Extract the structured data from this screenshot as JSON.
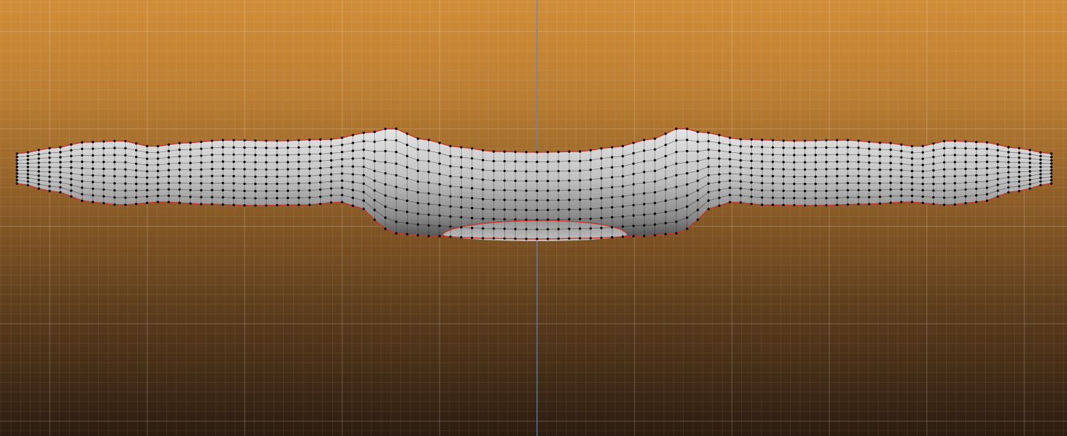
{
  "viewport": {
    "mode": "edit-mode",
    "background_top": "#d18e38",
    "background_bottom": "#2c1d10",
    "grid_color": "#ffffff",
    "axis_color": "#5c86c9"
  },
  "mesh": {
    "object": "symmetric-wing-shape",
    "fill_color": "#c4c4c4",
    "shadow_color": "#5a5a5a",
    "wire_color": "#1f1f1f",
    "vertex_color": "#000000",
    "boundary_edge_color": "#c8352a",
    "symmetry": "mirror-x"
  }
}
